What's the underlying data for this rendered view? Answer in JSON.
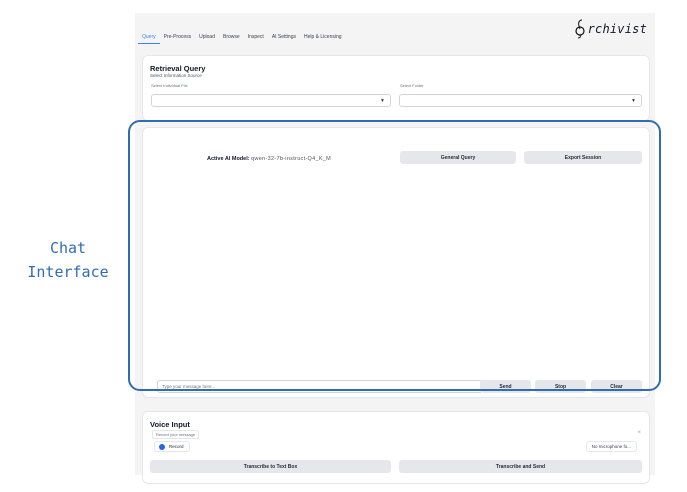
{
  "tabs": [
    "Query",
    "Pre-Process",
    "Upload",
    "Browse",
    "Inspect",
    "AI Settings",
    "Help & Licensing"
  ],
  "active_tab": "Query",
  "logo": {
    "text": "rchivist",
    "mark": "a"
  },
  "retrieval": {
    "title": "Retrieval Query",
    "subtitle": "Select Information Source",
    "left_label": "Select Individual File",
    "right_label": "Select Folder",
    "left_value": "",
    "right_value": ""
  },
  "chat": {
    "model_prefix": "Active AI Model:",
    "model_name": "qwen-32-7b-instruct-Q4_K_M",
    "general_query": "General Query",
    "export_session": "Export Session",
    "message_placeholder": "Type your message here...",
    "send": "Send",
    "stop": "Stop",
    "clear": "Clear"
  },
  "voice": {
    "title": "Voice Input",
    "mic_label": "Record your message",
    "record": "Record",
    "mic_select": "No microphone fo...",
    "close": "×",
    "transcribe_text": "Transcribe to Text Box",
    "transcribe_send": "Transcribe and Send"
  },
  "annotation": {
    "label_line1": "Chat",
    "label_line2": "Interface",
    "color": "#2f6db3"
  }
}
